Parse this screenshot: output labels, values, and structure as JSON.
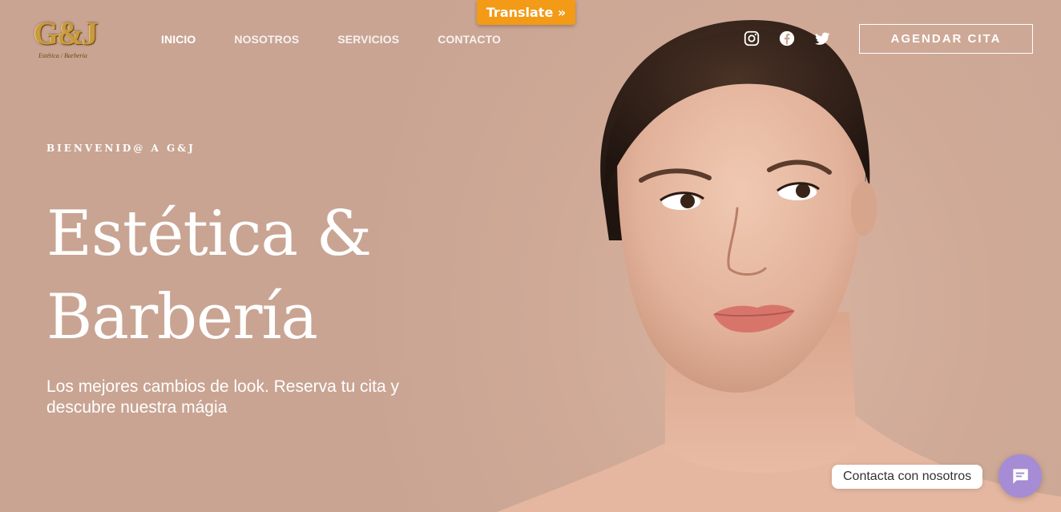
{
  "translate": {
    "label": "Translate »"
  },
  "logo": {
    "mark": "G&J",
    "tagline": "Estética / Barbería"
  },
  "nav": {
    "items": [
      {
        "label": "INICIO",
        "active": true
      },
      {
        "label": "NOSOTROS",
        "active": false
      },
      {
        "label": "SERVICIOS",
        "active": false
      },
      {
        "label": "CONTACTO",
        "active": false
      }
    ]
  },
  "social": {
    "icons": [
      "instagram-icon",
      "facebook-icon",
      "twitter-icon"
    ]
  },
  "cta": {
    "label": "AGENDAR CITA"
  },
  "hero": {
    "eyebrow": "BIENVENID@ A G&J",
    "headline_line1": "Estética &",
    "headline_line2": "Barbería",
    "subtext": "Los mejores cambios de look. Reserva tu cita y descubre nuestra mágia"
  },
  "chat": {
    "label": "Contacta con nosotros",
    "icon": "chat-icon"
  },
  "colors": {
    "background": "#c9a492",
    "translate_tab": "#f39a16",
    "chat_button": "#a58cd4"
  }
}
